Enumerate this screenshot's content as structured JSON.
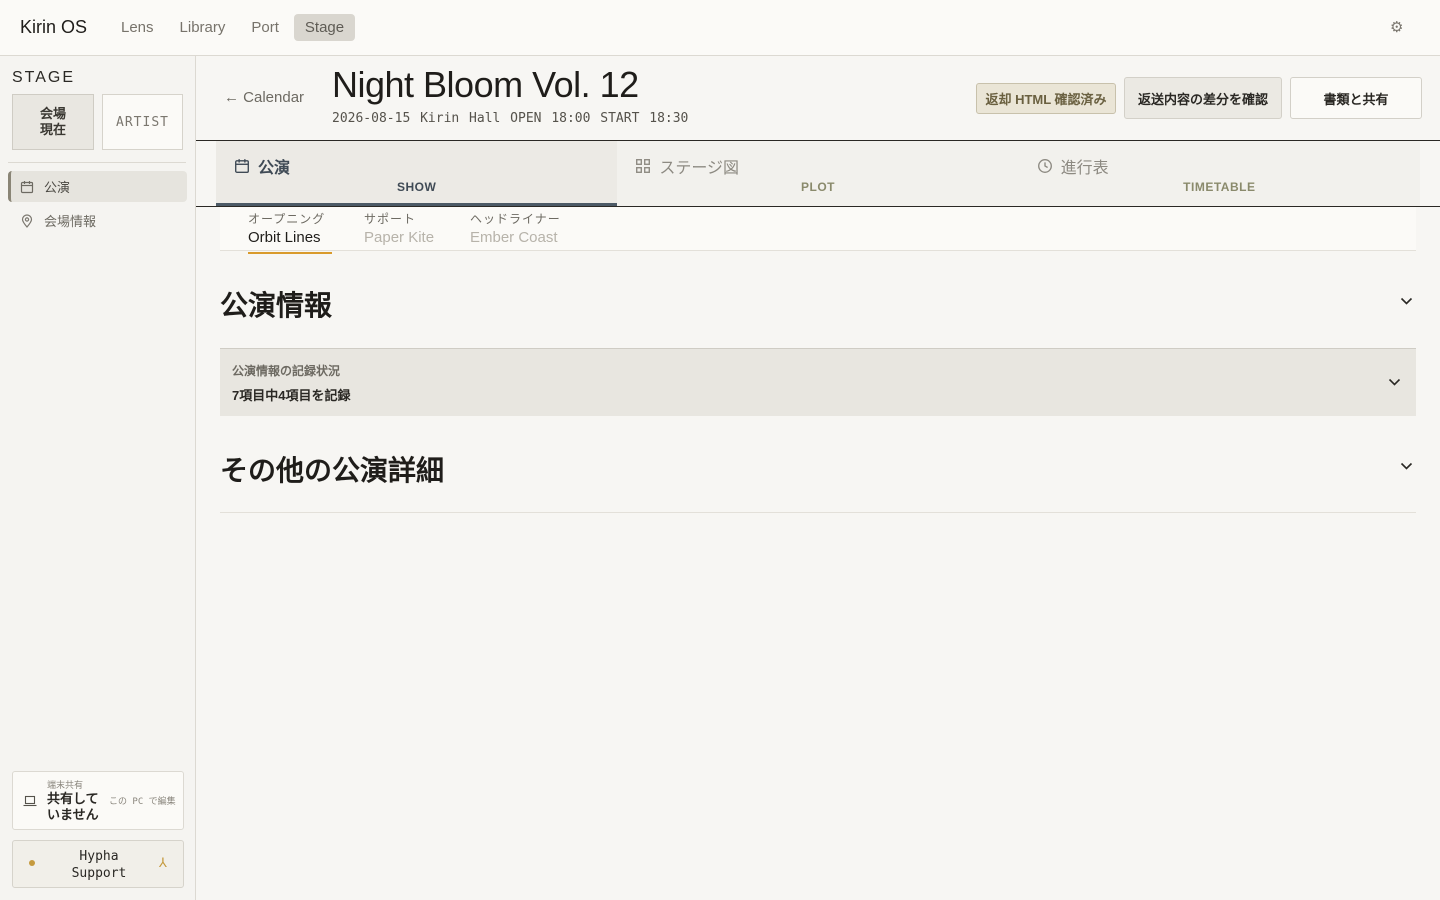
{
  "app": {
    "title": "Kirin OS"
  },
  "topnav": [
    "Lens",
    "Library",
    "Port",
    "Stage"
  ],
  "sidebar": {
    "section_title": "STAGE",
    "mode_venue_line1": "会場",
    "mode_venue_line2": "現在",
    "mode_artist": "ARTIST",
    "items": [
      {
        "label": "公演",
        "icon": "calendar-icon"
      },
      {
        "label": "会場情報",
        "icon": "map-pin-icon"
      }
    ],
    "share": {
      "caption": "端末共有",
      "status": "共有していません",
      "edit": "この PC で編集"
    },
    "support": {
      "label": "Hypha Support",
      "toggle": "⅄"
    }
  },
  "header": {
    "back": "← Calendar",
    "title": "Night Bloom Vol. 12",
    "meta": "2026-08-15  Kirin Hall  OPEN 18:00  START 18:30",
    "buttons": {
      "html_confirmed": "返却 HTML 確認済み",
      "diff": "返送内容の差分を確認",
      "share": "書類と共有"
    }
  },
  "tabs": [
    {
      "jp": "公演",
      "en": "SHOW",
      "icon": "calendar-icon"
    },
    {
      "jp": "ステージ図",
      "en": "PLOT",
      "icon": "grid-icon"
    },
    {
      "jp": "進行表",
      "en": "TIMETABLE",
      "icon": "clock-icon"
    }
  ],
  "subtabs": [
    {
      "kind": "オープニング",
      "name": "Orbit Lines"
    },
    {
      "kind": "サポート",
      "name": "Paper Kite"
    },
    {
      "kind": "ヘッドライナー",
      "name": "Ember Coast"
    }
  ],
  "sections": {
    "info_title": "公演情報",
    "status_label": "公演情報の記録状況",
    "status_value": "7項目中4項目を記録",
    "other_title": "その他の公演詳細"
  },
  "colors": {
    "accent_tab": "#4c5a66",
    "subtab_underline": "#d99a2b",
    "support_dot": "#c59a3e"
  }
}
